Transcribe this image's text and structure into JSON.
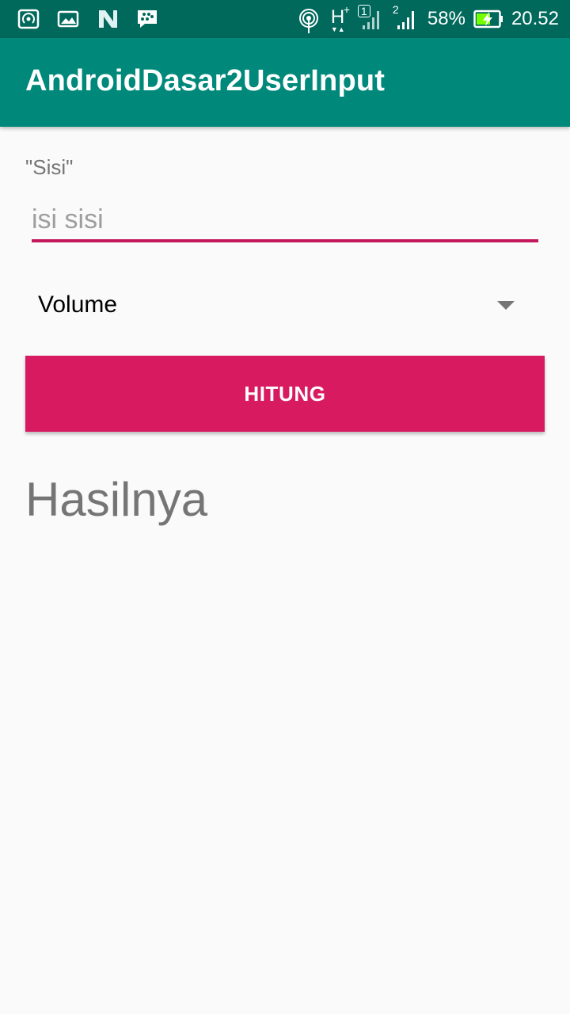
{
  "status_bar": {
    "left_icons": [
      "hotspot-icon",
      "image-icon",
      "n-logo-icon",
      "bbm-icon"
    ],
    "right_icons": [
      "wireless-icon",
      "network-h-plus-icon",
      "signal-sim1-icon",
      "signal-sim2-icon",
      "battery-charging-icon"
    ],
    "network_type": "H",
    "sim1_label": "1",
    "sim2_label": "2",
    "battery": "58%",
    "time": "20.52"
  },
  "app_bar": {
    "title": "AndroidDasar2UserInput",
    "color": "#00897b"
  },
  "form": {
    "sisi_label": "\"Sisi\"",
    "sisi_placeholder": "isi sisi",
    "sisi_value": "",
    "accent_color": "#c2185b",
    "spinner_selected": "Volume",
    "button_label": "HITUNG",
    "button_color": "#d81b60"
  },
  "result": {
    "text": "Hasilnya"
  }
}
